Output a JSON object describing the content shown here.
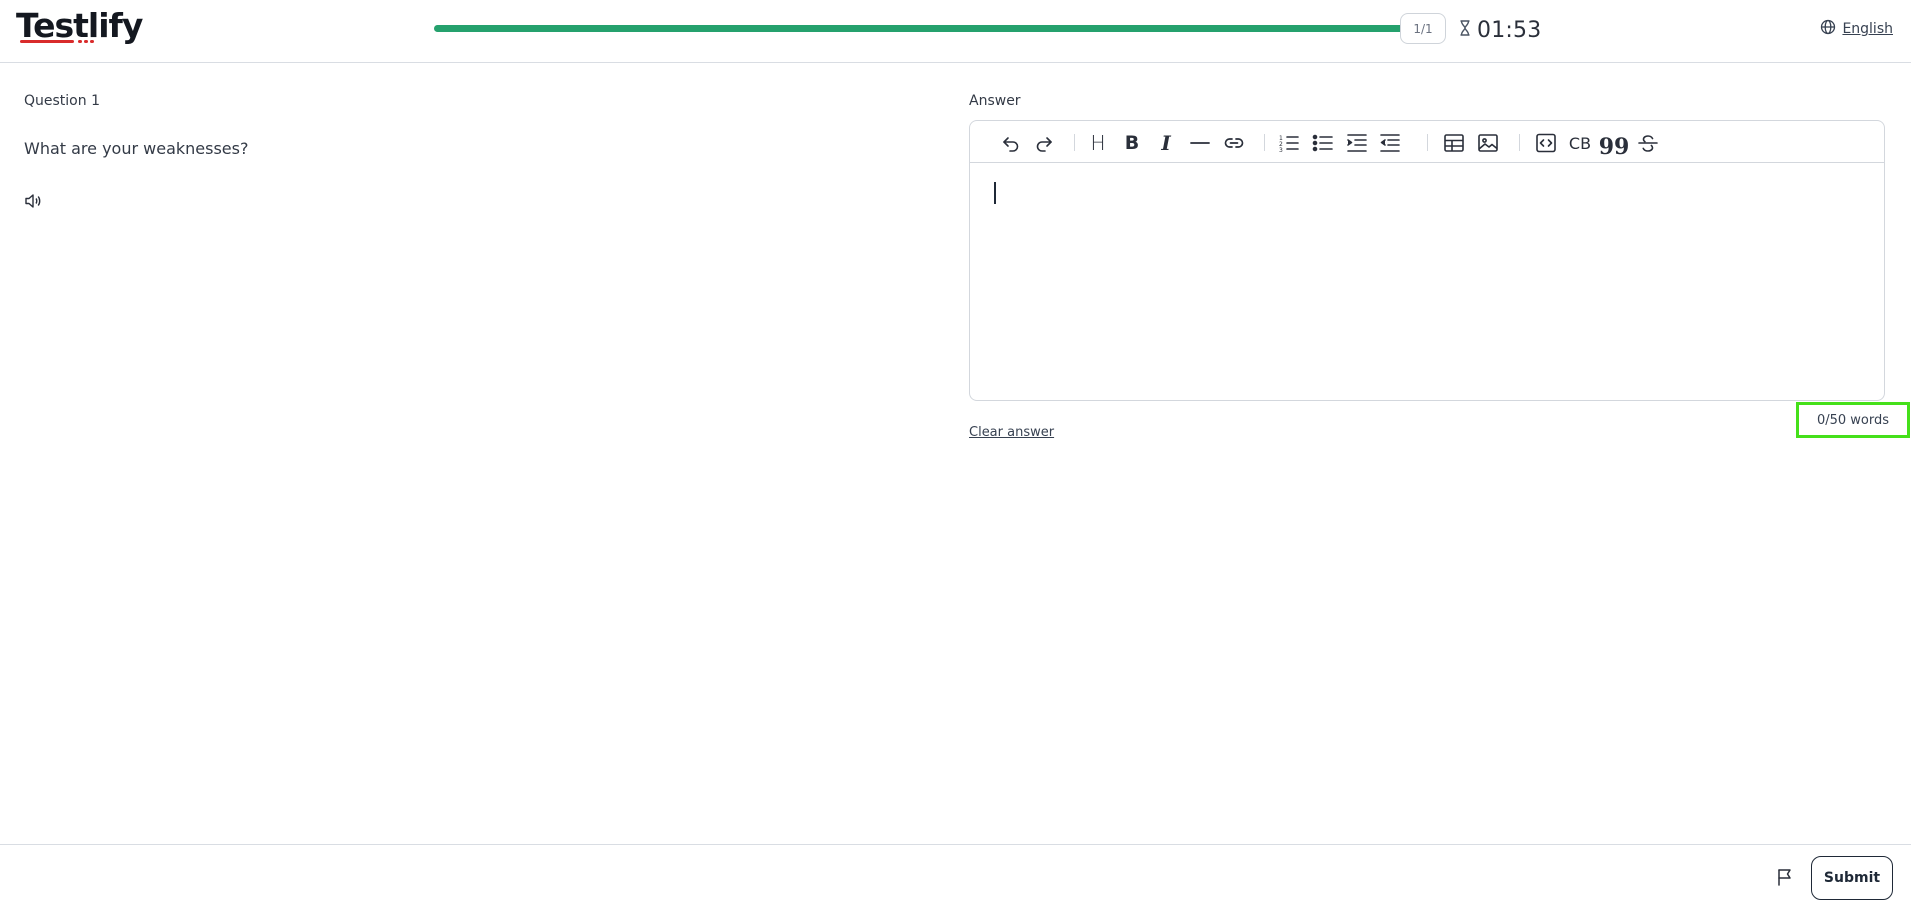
{
  "header": {
    "logo": "Testlify",
    "progress": 1.0,
    "progress_color": "#25a16d",
    "counter": "1/1",
    "timer_icon": "hourglass-icon",
    "timer": "01:53",
    "language": "English",
    "language_icon": "globe-icon"
  },
  "question": {
    "label": "Question 1",
    "text": "What are your weaknesses?",
    "audio_icon": "speaker-icon"
  },
  "answer": {
    "label": "Answer",
    "toolbar": {
      "items": [
        "undo",
        "redo",
        "heading",
        "bold",
        "italic",
        "horizontal-rule",
        "link",
        "ordered-list",
        "bullet-list",
        "indent",
        "outdent",
        "table",
        "image",
        "code",
        "code-block",
        "blockquote",
        "strikethrough"
      ],
      "heading_label": "H",
      "bold_label": "B",
      "italic_label": "I",
      "code_block_label": "CB",
      "quote_label": "99"
    },
    "word_count": "0/50 words",
    "clear_label": "Clear answer"
  },
  "footer": {
    "flag_icon": "flag-icon",
    "submit_label": "Submit"
  },
  "colors": {
    "accent": "#25a16d",
    "logo_underline": "#d92b2b",
    "highlight_box": "#45e01a"
  }
}
